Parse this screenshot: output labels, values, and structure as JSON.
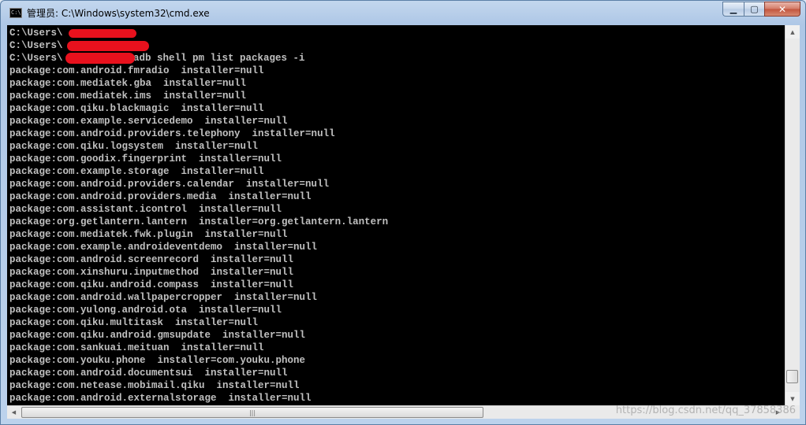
{
  "window": {
    "title": "管理员: C:\\Windows\\system32\\cmd.exe",
    "icon": "cmd-icon",
    "icon_text": "C:\\",
    "minimize_label": "▁",
    "maximize_label": "▢",
    "close_label": "✕"
  },
  "console": {
    "lines": [
      "C:\\Users\\",
      "C:\\Users\\",
      "C:\\Users\\",
      "package:com.android.fmradio  installer=null",
      "package:com.mediatek.gba  installer=null",
      "package:com.mediatek.ims  installer=null",
      "package:com.qiku.blackmagic  installer=null",
      "package:com.example.servicedemo  installer=null",
      "package:com.android.providers.telephony  installer=null",
      "package:com.qiku.logsystem  installer=null",
      "package:com.goodix.fingerprint  installer=null",
      "package:com.example.storage  installer=null",
      "package:com.android.providers.calendar  installer=null",
      "package:com.android.providers.media  installer=null",
      "package:com.assistant.icontrol  installer=null",
      "package:org.getlantern.lantern  installer=org.getlantern.lantern",
      "package:com.mediatek.fwk.plugin  installer=null",
      "package:com.example.androideventdemo  installer=null",
      "package:com.android.screenrecord  installer=null",
      "package:com.xinshuru.inputmethod  installer=null",
      "package:com.qiku.android.compass  installer=null",
      "package:com.android.wallpapercropper  installer=null",
      "package:com.yulong.android.ota  installer=null",
      "package:com.qiku.multitask  installer=null",
      "package:com.qiku.android.gmsupdate  installer=null",
      "package:com.sankuai.meituan  installer=null",
      "package:com.youku.phone  installer=com.youku.phone",
      "package:com.android.documentsui  installer=null",
      "package:com.netease.mobimail.qiku  installer=null",
      "package:com.android.externalstorage  installer=null"
    ],
    "prompt_suffix_1": ">",
    "prompt_suffix_2": ">",
    "prompt_suffix_3": ">adb shell pm list packages -i",
    "text_color": "#c0c0c0",
    "background": "#000000"
  },
  "scrollbars": {
    "vertical_up": "▲",
    "vertical_down": "▼",
    "horizontal_left": "◀",
    "horizontal_right": "▶",
    "horizontal_grip": "|||"
  },
  "watermark": "https://blog.csdn.net/qq_37858386"
}
